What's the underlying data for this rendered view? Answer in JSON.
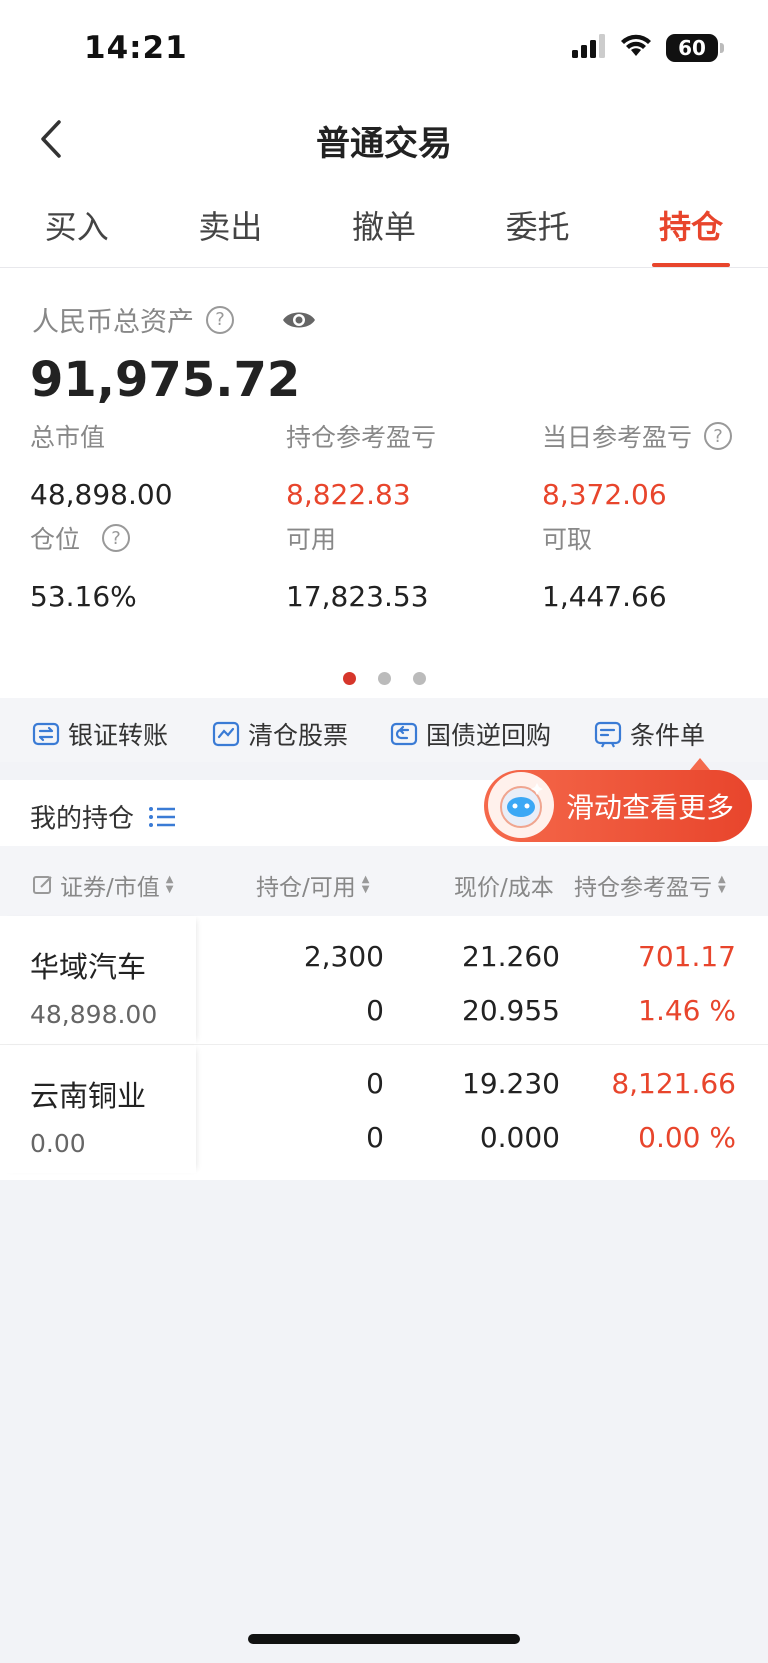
{
  "status_bar": {
    "time": "14:21",
    "battery": "60"
  },
  "nav": {
    "title": "普通交易"
  },
  "tabs": [
    {
      "label": "买入"
    },
    {
      "label": "卖出"
    },
    {
      "label": "撤单"
    },
    {
      "label": "委托"
    },
    {
      "label": "持仓",
      "active": true
    }
  ],
  "assets": {
    "label": "人民币总资产",
    "total": "91,975.72",
    "stats": [
      {
        "label": "总市值",
        "value": "48,898.00"
      },
      {
        "label": "持仓参考盈亏",
        "value": "8,822.83"
      },
      {
        "label": "当日参考盈亏",
        "value": "8,372.06"
      },
      {
        "label": "仓位",
        "value": "53.16%"
      },
      {
        "label": "可用",
        "value": "17,823.53"
      },
      {
        "label": "可取",
        "value": "1,447.66"
      }
    ]
  },
  "pager": {
    "count": 3,
    "active": 0
  },
  "quick_actions": [
    {
      "label": "银证转账",
      "icon": "transfer-icon"
    },
    {
      "label": "清仓股票",
      "icon": "chart-icon"
    },
    {
      "label": "国债逆回购",
      "icon": "repo-icon"
    },
    {
      "label": "条件单",
      "icon": "condition-order-icon"
    }
  ],
  "holdings": {
    "title": "我的持仓",
    "scroll_hint": "滑动查看更多",
    "columns": [
      "证券/市值",
      "持仓/可用",
      "现价/成本",
      "持仓参考盈亏"
    ],
    "rows": [
      {
        "name": "华域汽车",
        "market_value": "48,898.00",
        "position": "2,300",
        "available": "0",
        "price": "21.260",
        "cost": "20.955",
        "pnl": "701.17",
        "pnl_pct": "1.46 %"
      },
      {
        "name": "云南铜业",
        "market_value": "0.00",
        "position": "0",
        "available": "0",
        "price": "19.230",
        "cost": "0.000",
        "pnl": "8,121.66",
        "pnl_pct": "0.00 %"
      }
    ]
  },
  "colors": {
    "accent": "#e8452c",
    "page_bg": "#f2f3f7",
    "icon_blue": "#3a7bd5"
  }
}
